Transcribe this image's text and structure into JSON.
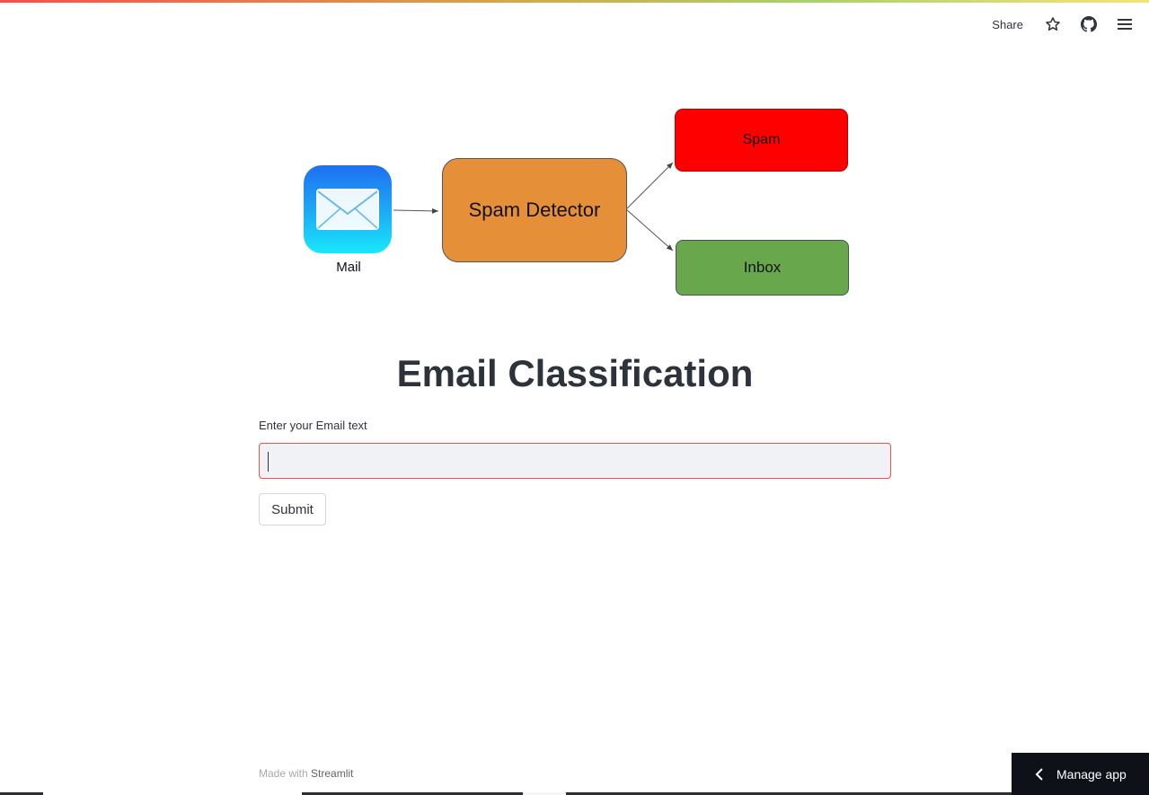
{
  "toolbar": {
    "share_label": "Share",
    "icons": [
      "star-icon",
      "github-icon",
      "hamburger-menu-icon"
    ]
  },
  "diagram": {
    "mail_label": "Mail",
    "detector_label": "Spam Detector",
    "spam_label": "Spam",
    "inbox_label": "Inbox",
    "colors": {
      "mail_top": "#1f6ff0",
      "mail_bottom": "#1ae8fb",
      "detector": "#e58f39",
      "spam": "#ff0000",
      "inbox": "#69a74c"
    }
  },
  "main": {
    "title": "Email Classification",
    "input_label": "Enter your Email text",
    "input_value": "",
    "submit_label": "Submit"
  },
  "footer": {
    "made_with": "Made with",
    "brand": "Streamlit"
  },
  "manage_app": {
    "label": "Manage app"
  },
  "colors": {
    "accent_red": "#ff4b4b",
    "input_bg": "#f0f2f6",
    "dark_panel": "#0e1117"
  }
}
